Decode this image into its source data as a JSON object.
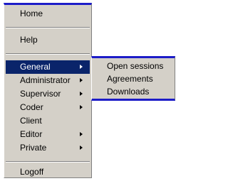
{
  "menu": {
    "items": [
      {
        "label": "Home"
      },
      {
        "label": "Help"
      },
      {
        "label": "General"
      },
      {
        "label": "Administrator"
      },
      {
        "label": "Supervisor"
      },
      {
        "label": "Coder"
      },
      {
        "label": "Client"
      },
      {
        "label": "Editor"
      },
      {
        "label": "Private"
      },
      {
        "label": "Logoff"
      }
    ]
  },
  "submenu": {
    "items": [
      {
        "label": "Open sessions"
      },
      {
        "label": "Agreements"
      },
      {
        "label": "Downloads"
      }
    ]
  },
  "colors": {
    "menu_background": "#d4d0c8",
    "highlight": "#0a246a",
    "accent_border": "#1c1cc8"
  },
  "icons": {
    "submenu_arrow": "triangle-right"
  }
}
